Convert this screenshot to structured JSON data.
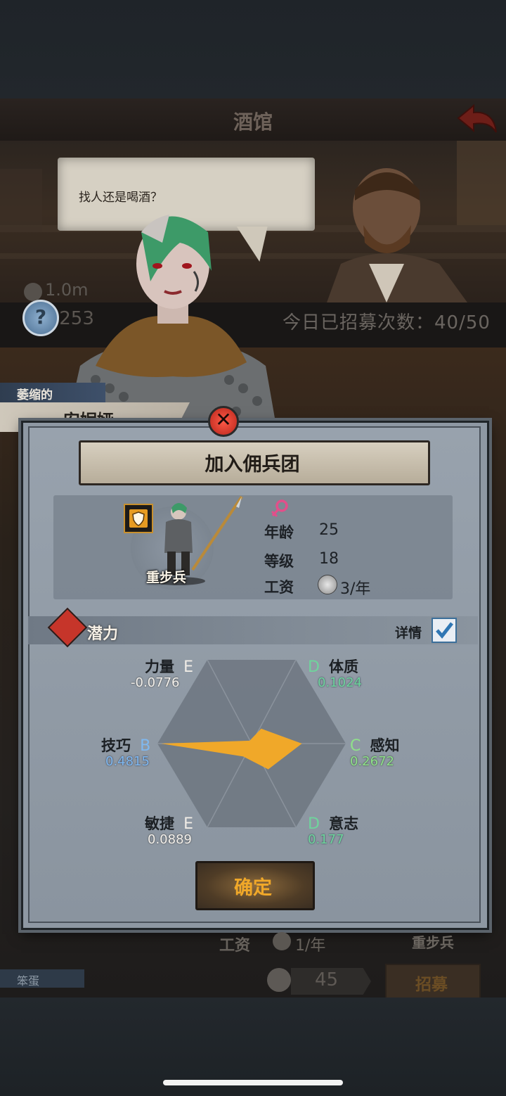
{
  "header": {
    "title": "酒馆"
  },
  "bubble": {
    "text": "找人还是喝酒？"
  },
  "stats_bar": {
    "money": "1.0m",
    "count_partial": ".253",
    "recruit_count": "今日已招募次数：40/50"
  },
  "character": {
    "adjective": "萎缩的",
    "name": "安妮娅"
  },
  "modal": {
    "title": "加入佣兵团",
    "unit_class": "重步兵",
    "age_label": "年龄",
    "age_value": "25",
    "level_label": "等级",
    "level_value": "18",
    "wage_label": "工资",
    "wage_value": "3/年",
    "potential_label": "潜力",
    "detail_label": "详情",
    "confirm_label": "确定",
    "radar": [
      {
        "name": "力量",
        "grade": "E",
        "value": "-0.0776"
      },
      {
        "name": "体质",
        "grade": "D",
        "value": "0.1024"
      },
      {
        "name": "感知",
        "grade": "C",
        "value": "0.2672"
      },
      {
        "name": "意志",
        "grade": "D",
        "value": "0.177"
      },
      {
        "name": "敏捷",
        "grade": "E",
        "value": "0.0889"
      },
      {
        "name": "技巧",
        "grade": "B",
        "value": "0.4815"
      }
    ]
  },
  "behind": {
    "wage_label": "工资",
    "wage_value": "1/年",
    "class": "重步兵",
    "adjective": "笨蛋",
    "price": "45",
    "recruit_label": "招募"
  },
  "colors": {
    "accent_orange": "#f0a829",
    "radar_fill": "#f0a829",
    "close_red": "#d9382a"
  }
}
